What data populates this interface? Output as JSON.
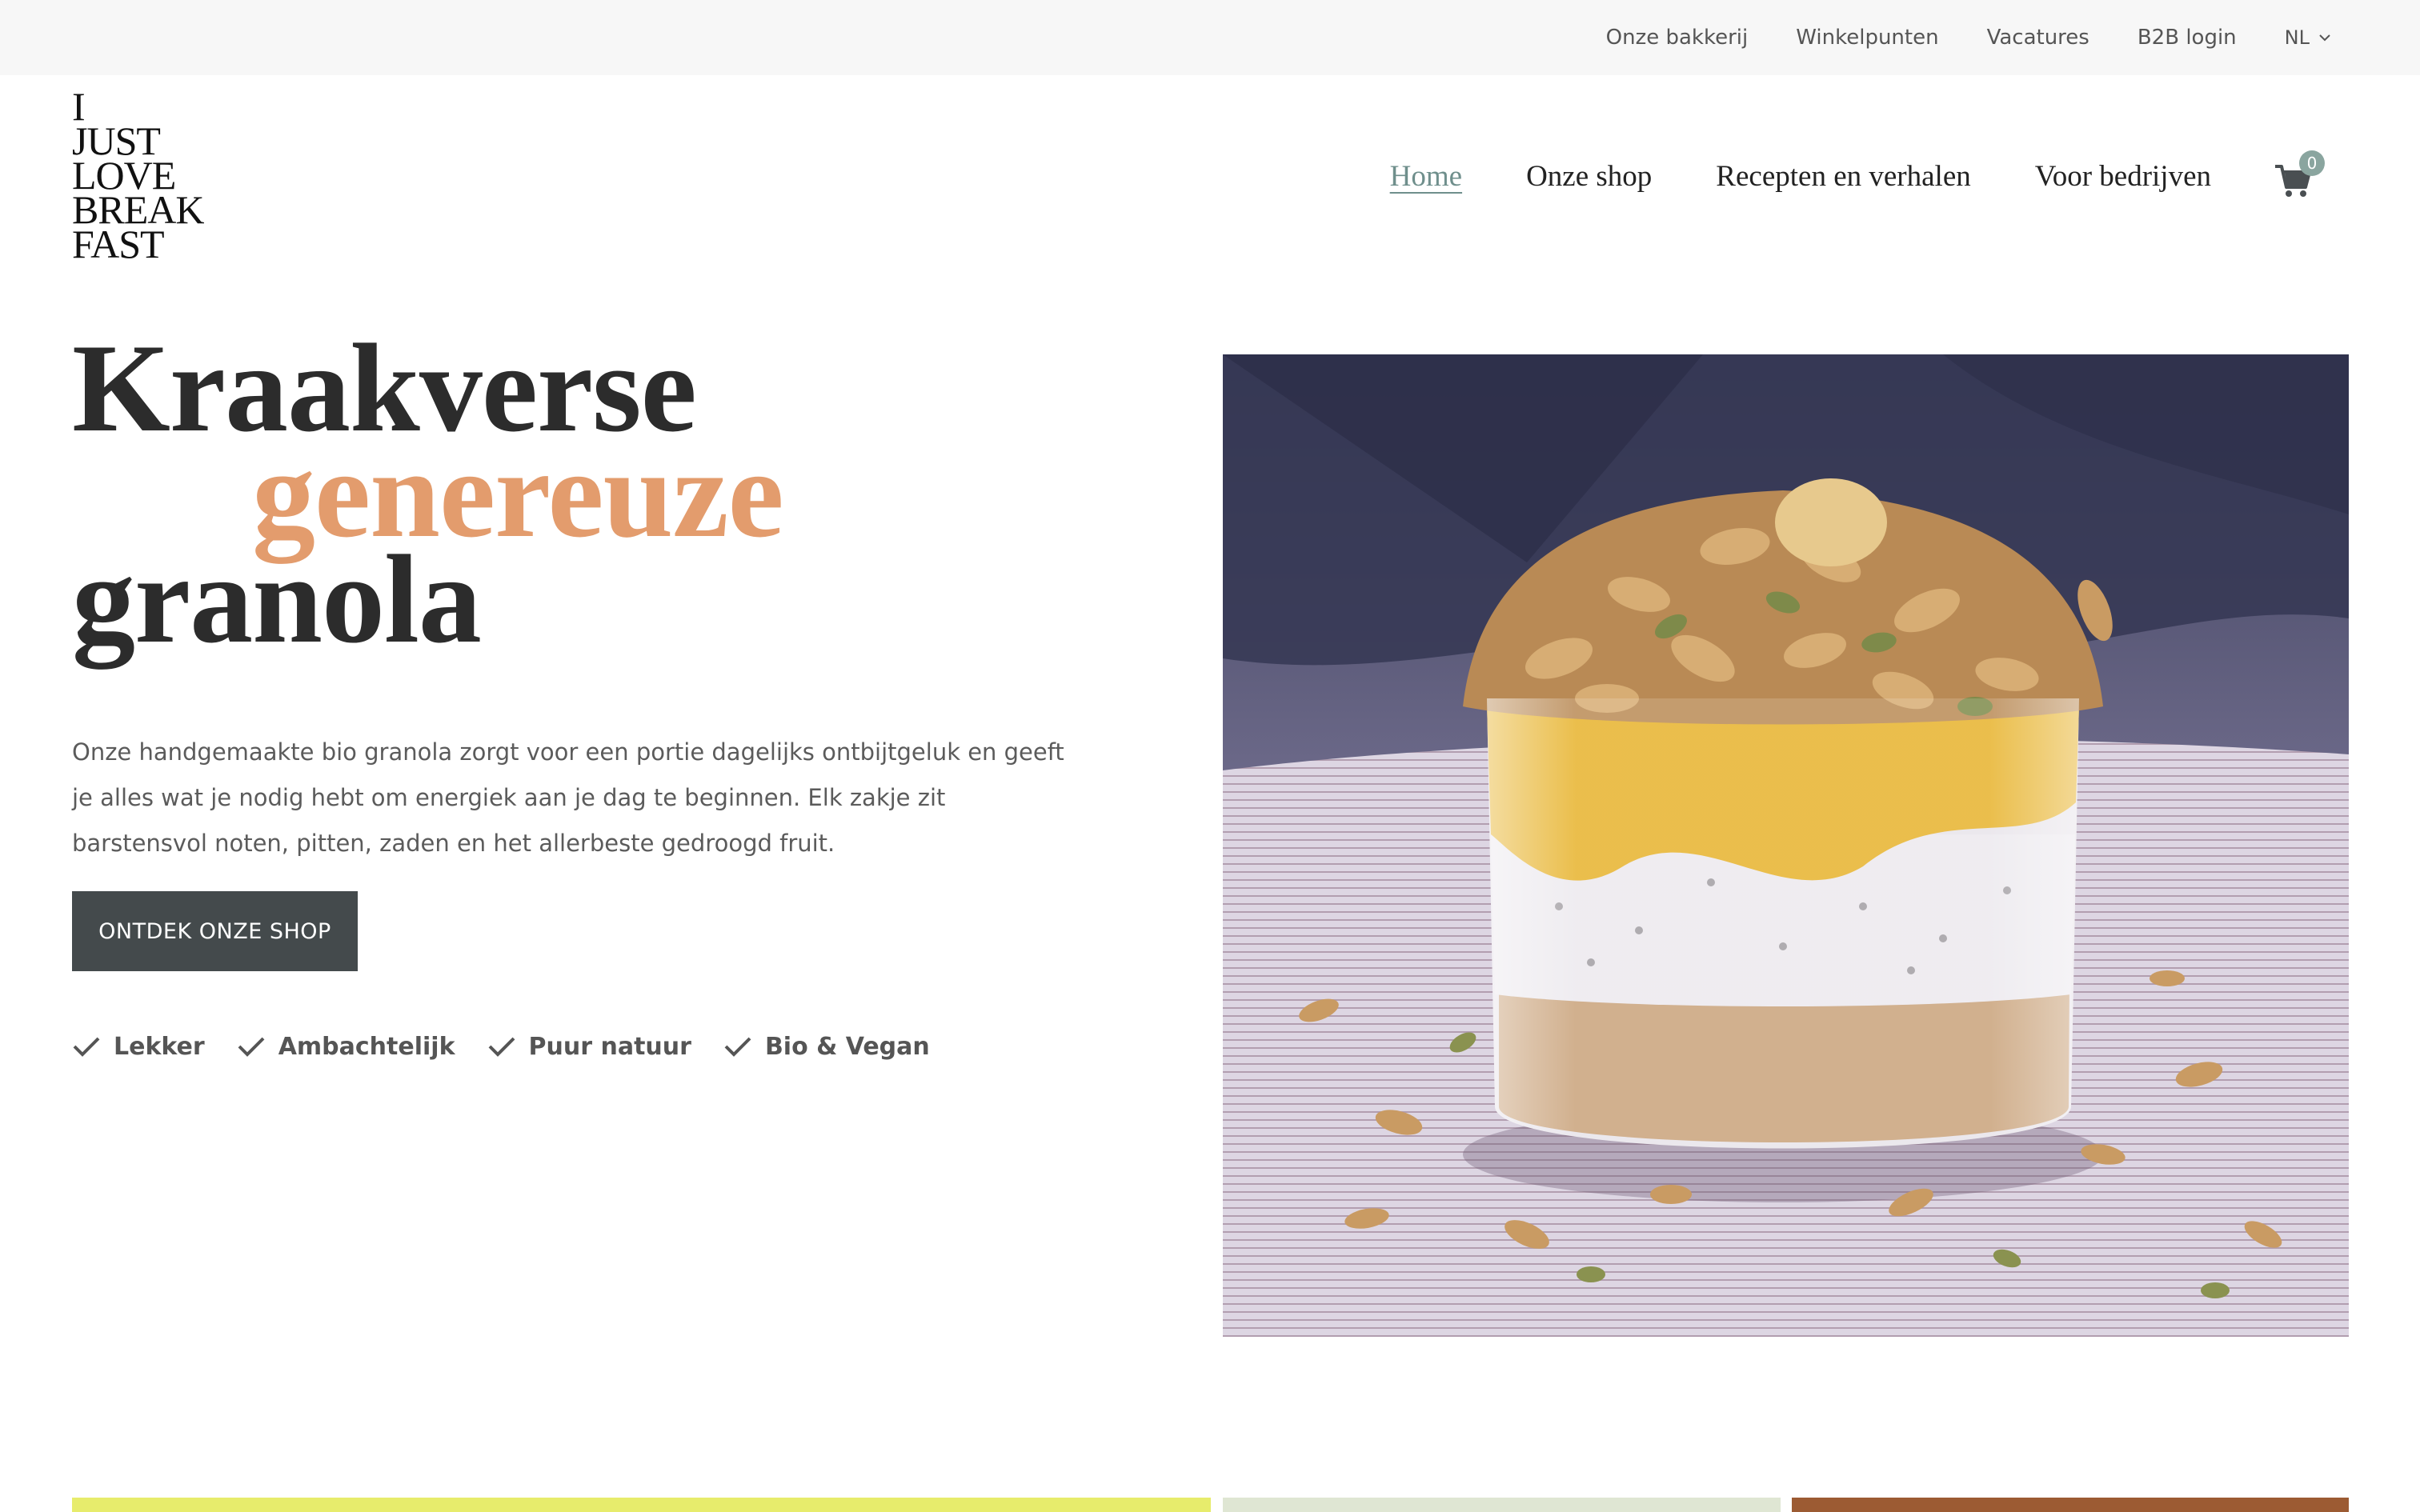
{
  "topbar": {
    "links": [
      "Onze bakkerij",
      "Winkelpunten",
      "Vacatures",
      "B2B login"
    ],
    "language": "NL"
  },
  "logo": {
    "lines": [
      "I",
      "JUST",
      "LOVE",
      "BREAK",
      "FAST"
    ]
  },
  "nav": {
    "items": [
      "Home",
      "Onze shop",
      "Recepten en verhalen",
      "Voor bedrijven"
    ],
    "active": "Home",
    "cart_count": "0"
  },
  "hero": {
    "title_line1": "Kraakverse",
    "title_line2": "genereuze",
    "title_line3": "granola",
    "intro": "Onze handgemaakte bio granola zorgt voor een portie dagelijks ontbijtgeluk en geeft je alles wat je nodig hebt om energiek aan je dag te beginnen. Elk zakje zit barstensvol noten, pitten, zaden en het allerbeste gedroogd fruit.",
    "cta_label": "ONTDEK ONZE SHOP",
    "features": [
      "Lekker",
      "Ambachtelijk",
      "Puur natuur",
      "Bio & Vegan"
    ]
  },
  "colors": {
    "accent": "#e39c6d",
    "nav_active": "#6f8f8c",
    "cta_bg": "#444a4c",
    "strip_1": "#e7ec6c",
    "strip_2": "#dfe6d3",
    "strip_3": "#9c5b33"
  },
  "icons": {
    "language_caret": "chevron-down-icon",
    "cart": "cart-icon",
    "feature_check": "check-icon"
  }
}
